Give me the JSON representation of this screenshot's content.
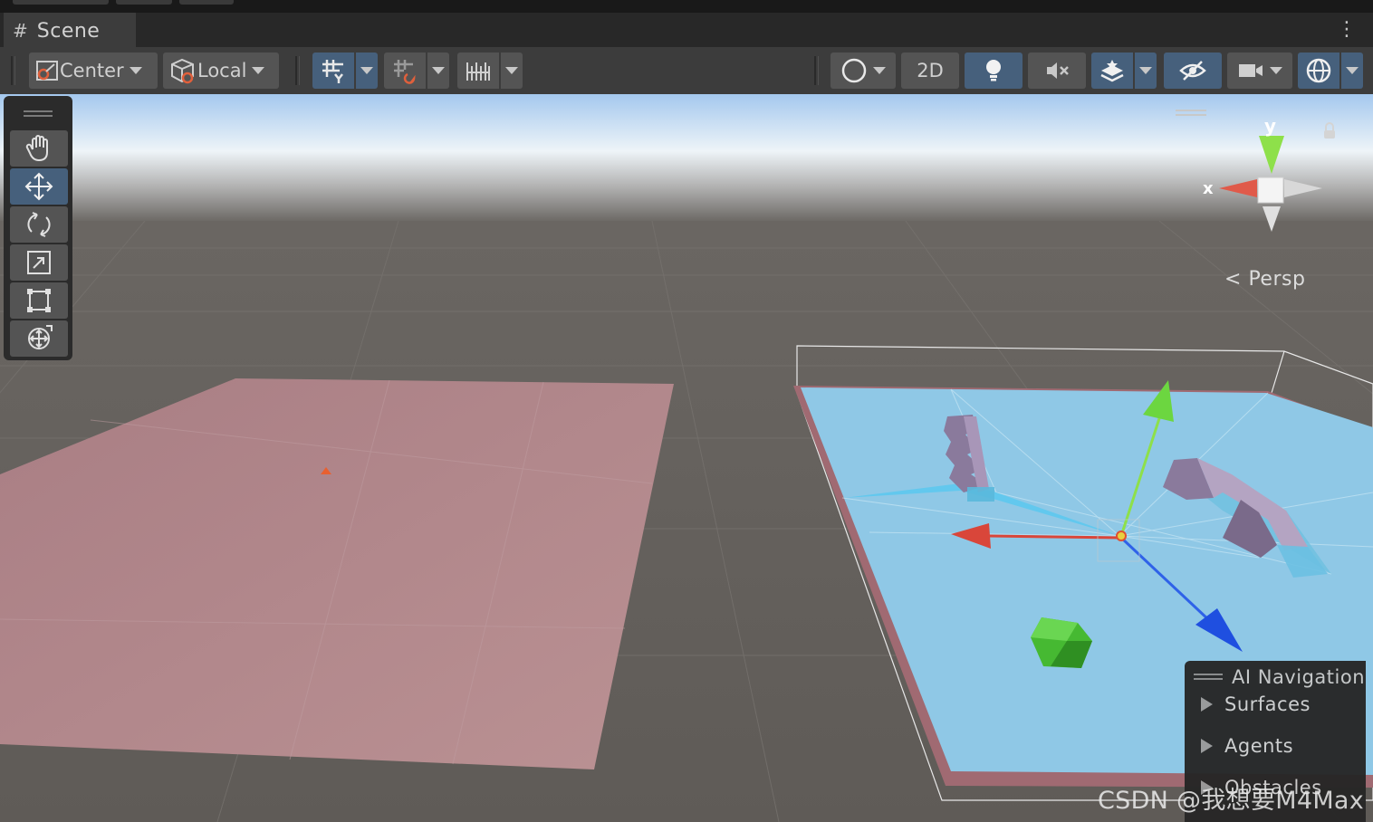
{
  "tab": {
    "icon": "grid-hash-icon",
    "label": "Scene"
  },
  "toolbar": {
    "pivot_label": "Center",
    "space_label": "Local",
    "mode_2d_label": "2D"
  },
  "tools": [
    "hand-tool",
    "move-tool",
    "rotate-tool",
    "scale-tool",
    "rect-tool",
    "transform-tool"
  ],
  "active_tool": "move-tool",
  "gizmo": {
    "y_label": "y",
    "x_label": "x",
    "projection_label": "Persp"
  },
  "ai_navigation": {
    "title": "AI Navigation",
    "items": [
      "Surfaces",
      "Agents",
      "Obstacles"
    ]
  },
  "watermark": "CSDN @我想要M4Max",
  "colors": {
    "active_button": "#46607c",
    "navmesh": "#8fc8e6",
    "plane": "#b4868c",
    "x_axis": "#d9463a",
    "y_axis": "#8ee04a",
    "z_axis": "#1f4fe0",
    "cube": "#4cc13a"
  }
}
